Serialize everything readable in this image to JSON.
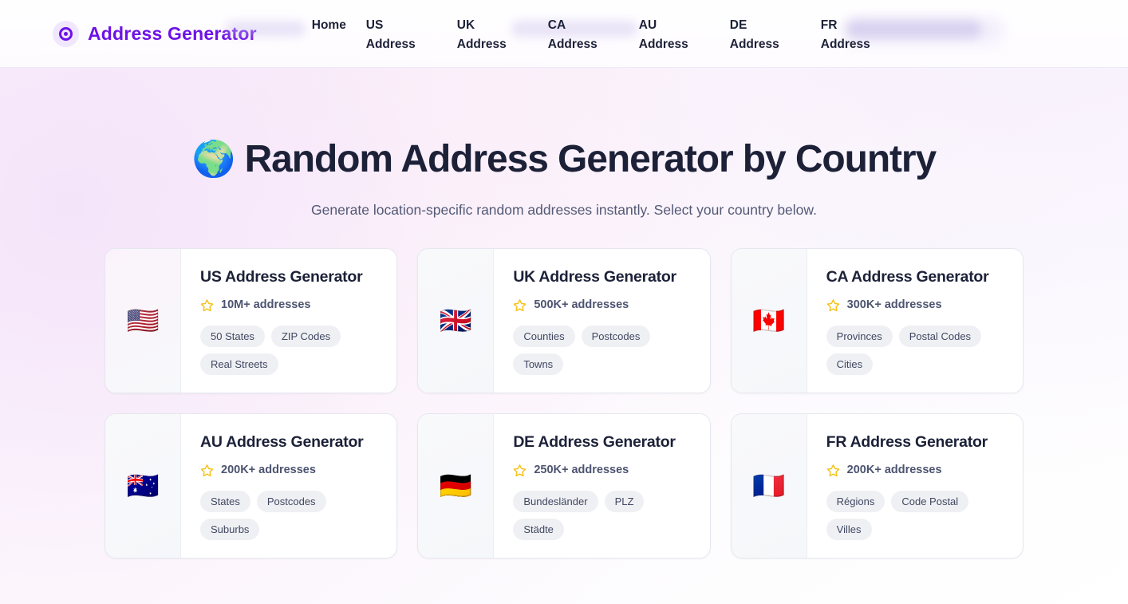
{
  "header": {
    "brand": {
      "icon": "target-circle-icon",
      "name": "Address  Generator",
      "color": "#6d12e8"
    },
    "nav": [
      {
        "label": "Home",
        "name": "home"
      },
      {
        "label": "US\nAddress",
        "name": "us-address"
      },
      {
        "label": "UK\nAddress",
        "name": "uk-address"
      },
      {
        "label": "CA\nAddress",
        "name": "ca-address"
      },
      {
        "label": "AU\nAddress",
        "name": "au-address"
      },
      {
        "label": "DE\nAddress",
        "name": "de-address"
      },
      {
        "label": "FR\nAddress",
        "name": "fr-address"
      }
    ]
  },
  "hero": {
    "globe": "🌍",
    "title": "Random Address Generator by Country",
    "subtitle": "Generate location-specific random addresses instantly. Select your country below."
  },
  "cards": [
    {
      "code": "us",
      "flag": "🇺🇸",
      "title": "US Address Generator",
      "count": "10M+ addresses",
      "star": "star-outline-icon",
      "star_color": "#f5c116",
      "tags": [
        "50 States",
        "ZIP Codes",
        "Real Streets"
      ]
    },
    {
      "code": "uk",
      "flag": "🇬🇧",
      "title": "UK Address Generator",
      "count": "500K+ addresses",
      "star": "star-outline-icon",
      "star_color": "#f5c116",
      "tags": [
        "Counties",
        "Postcodes",
        "Towns"
      ]
    },
    {
      "code": "ca",
      "flag": "🇨🇦",
      "title": "CA Address Generator",
      "count": "300K+ addresses",
      "star": "star-outline-icon",
      "star_color": "#f5c116",
      "tags": [
        "Provinces",
        "Postal Codes",
        "Cities"
      ]
    },
    {
      "code": "au",
      "flag": "🇦🇺",
      "title": "AU Address Generator",
      "count": "200K+ addresses",
      "star": "star-outline-icon",
      "star_color": "#f5c116",
      "tags": [
        "States",
        "Postcodes",
        "Suburbs"
      ]
    },
    {
      "code": "de",
      "flag": "🇩🇪",
      "title": "DE Address Generator",
      "count": "250K+ addresses",
      "star": "star-outline-icon",
      "star_color": "#f5c116",
      "tags": [
        "Bundesländer",
        "PLZ",
        "Städte"
      ]
    },
    {
      "code": "fr",
      "flag": "🇫🇷",
      "title": "FR Address Generator",
      "count": "200K+ addresses",
      "star": "star-outline-icon",
      "star_color": "#f5c116",
      "tags": [
        "Régions",
        "Code Postal",
        "Villes"
      ]
    }
  ]
}
